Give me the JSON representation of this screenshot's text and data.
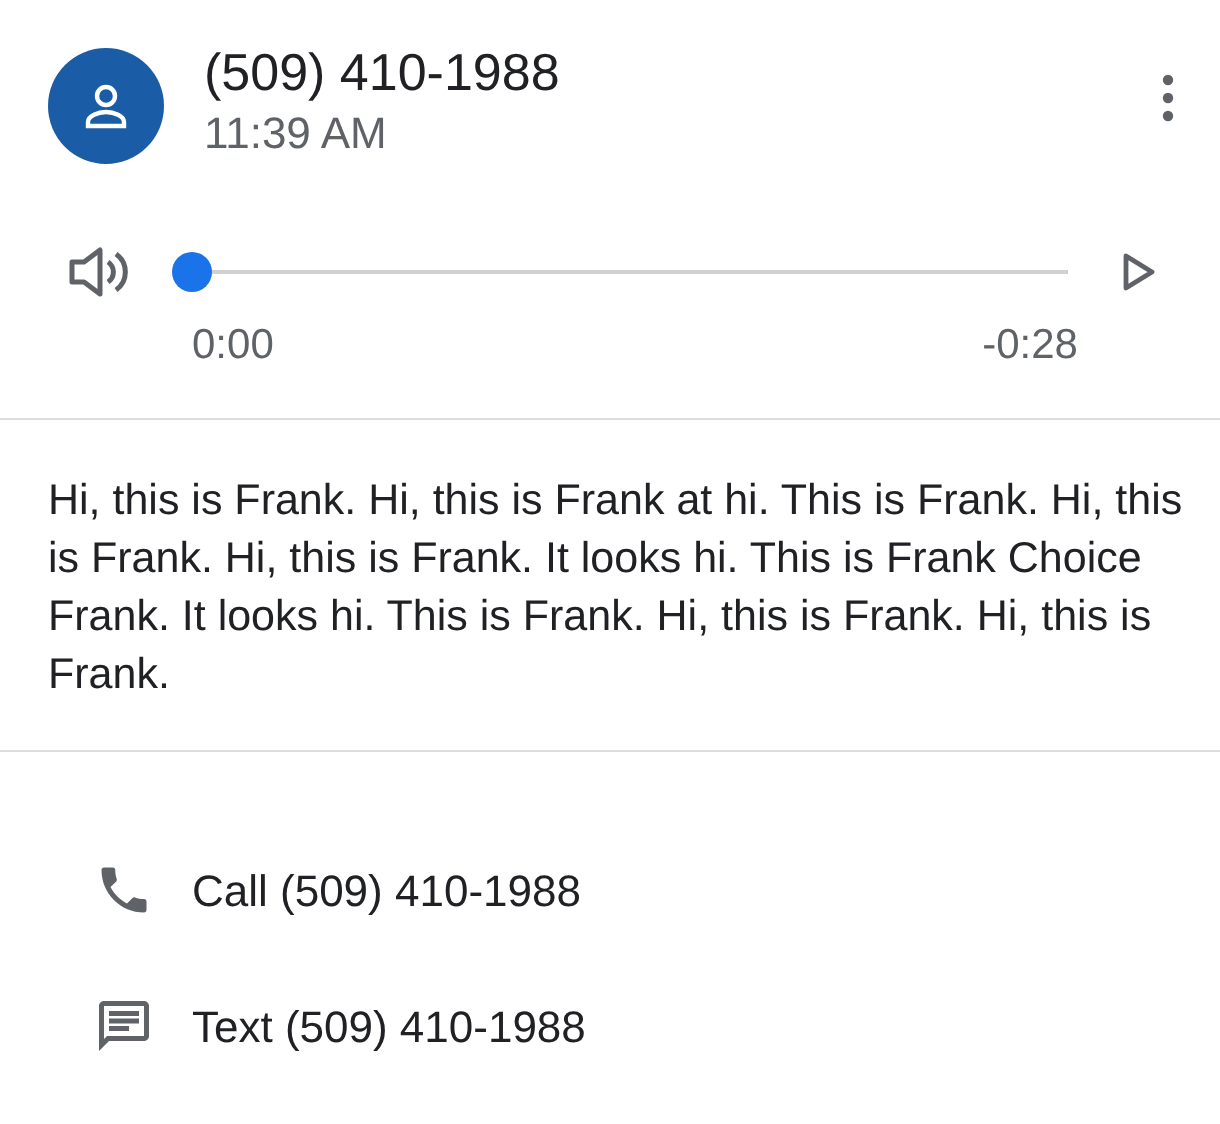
{
  "header": {
    "title": "(509) 410-1988",
    "time": "11:39 AM"
  },
  "player": {
    "level": 0,
    "elapsed": "0:00",
    "remaining": "-0:28"
  },
  "transcript": "Hi, this is Frank. Hi, this is Frank at hi. This is Frank. Hi, this is Frank. Hi, this is Frank. It looks hi. This is Frank Choice Frank. It looks hi. This is Frank. Hi, this is Frank. Hi, this is Frank.",
  "actions": [
    {
      "kind": "call",
      "label": "Call (509) 410-1988"
    },
    {
      "kind": "text",
      "label": "Text (509) 410-1988"
    }
  ]
}
